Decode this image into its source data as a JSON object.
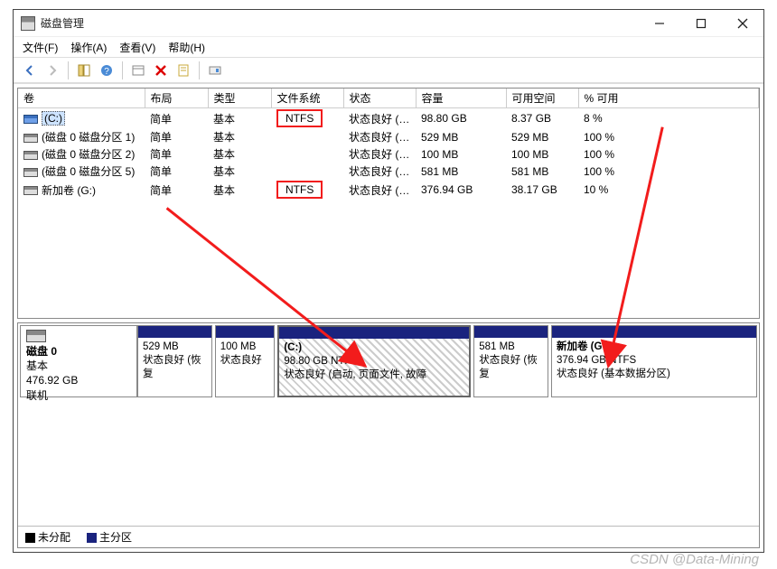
{
  "window": {
    "title": "磁盘管理"
  },
  "menu": {
    "file": "文件(F)",
    "action": "操作(A)",
    "view": "查看(V)",
    "help": "帮助(H)"
  },
  "columns": {
    "volume": "卷",
    "layout": "布局",
    "type": "类型",
    "filesystem": "文件系统",
    "status": "状态",
    "capacity": "容量",
    "free": "可用空间",
    "pctfree": "% 可用"
  },
  "volumes": [
    {
      "name": "(C:)",
      "layout": "简单",
      "type": "基本",
      "fs": "NTFS",
      "fs_hl": true,
      "status": "状态良好 (…",
      "cap": "98.80 GB",
      "free": "8.37 GB",
      "pct": "8 %",
      "selected": true
    },
    {
      "name": "(磁盘 0 磁盘分区 1)",
      "layout": "简单",
      "type": "基本",
      "fs": "",
      "fs_hl": false,
      "status": "状态良好 (…",
      "cap": "529 MB",
      "free": "529 MB",
      "pct": "100 %",
      "selected": false
    },
    {
      "name": "(磁盘 0 磁盘分区 2)",
      "layout": "简单",
      "type": "基本",
      "fs": "",
      "fs_hl": false,
      "status": "状态良好 (…",
      "cap": "100 MB",
      "free": "100 MB",
      "pct": "100 %",
      "selected": false
    },
    {
      "name": "(磁盘 0 磁盘分区 5)",
      "layout": "简单",
      "type": "基本",
      "fs": "",
      "fs_hl": false,
      "status": "状态良好 (…",
      "cap": "581 MB",
      "free": "581 MB",
      "pct": "100 %",
      "selected": false
    },
    {
      "name": "新加卷 (G:)",
      "layout": "简单",
      "type": "基本",
      "fs": "NTFS",
      "fs_hl": true,
      "status": "状态良好 (…",
      "cap": "376.94 GB",
      "free": "38.17 GB",
      "pct": "10 %",
      "selected": false
    }
  ],
  "disk": {
    "label_title": "磁盘 0",
    "label_type": "基本",
    "label_size": "476.92 GB",
    "label_state": "联机",
    "parts": [
      {
        "title": "",
        "line1": "529 MB",
        "line2": "状态良好 (恢复",
        "flex": 10,
        "hatched": false,
        "bold": false
      },
      {
        "title": "",
        "line1": "100 MB",
        "line2": "状态良好",
        "flex": 8,
        "hatched": false,
        "bold": false
      },
      {
        "title": "(C:)",
        "line1": "98.80 GB NTFS",
        "line2": "状态良好 (启动, 页面文件, 故障",
        "flex": 26,
        "hatched": true,
        "bold": true
      },
      {
        "title": "",
        "line1": "581 MB",
        "line2": "状态良好 (恢复",
        "flex": 10,
        "hatched": false,
        "bold": false
      },
      {
        "title": "新加卷  (G:)",
        "line1": "376.94 GB NTFS",
        "line2": "状态良好 (基本数据分区)",
        "flex": 28,
        "hatched": false,
        "bold": true
      }
    ]
  },
  "legend": {
    "unalloc": "未分配",
    "primary": "主分区"
  },
  "watermark": "CSDN @Data-Mining"
}
